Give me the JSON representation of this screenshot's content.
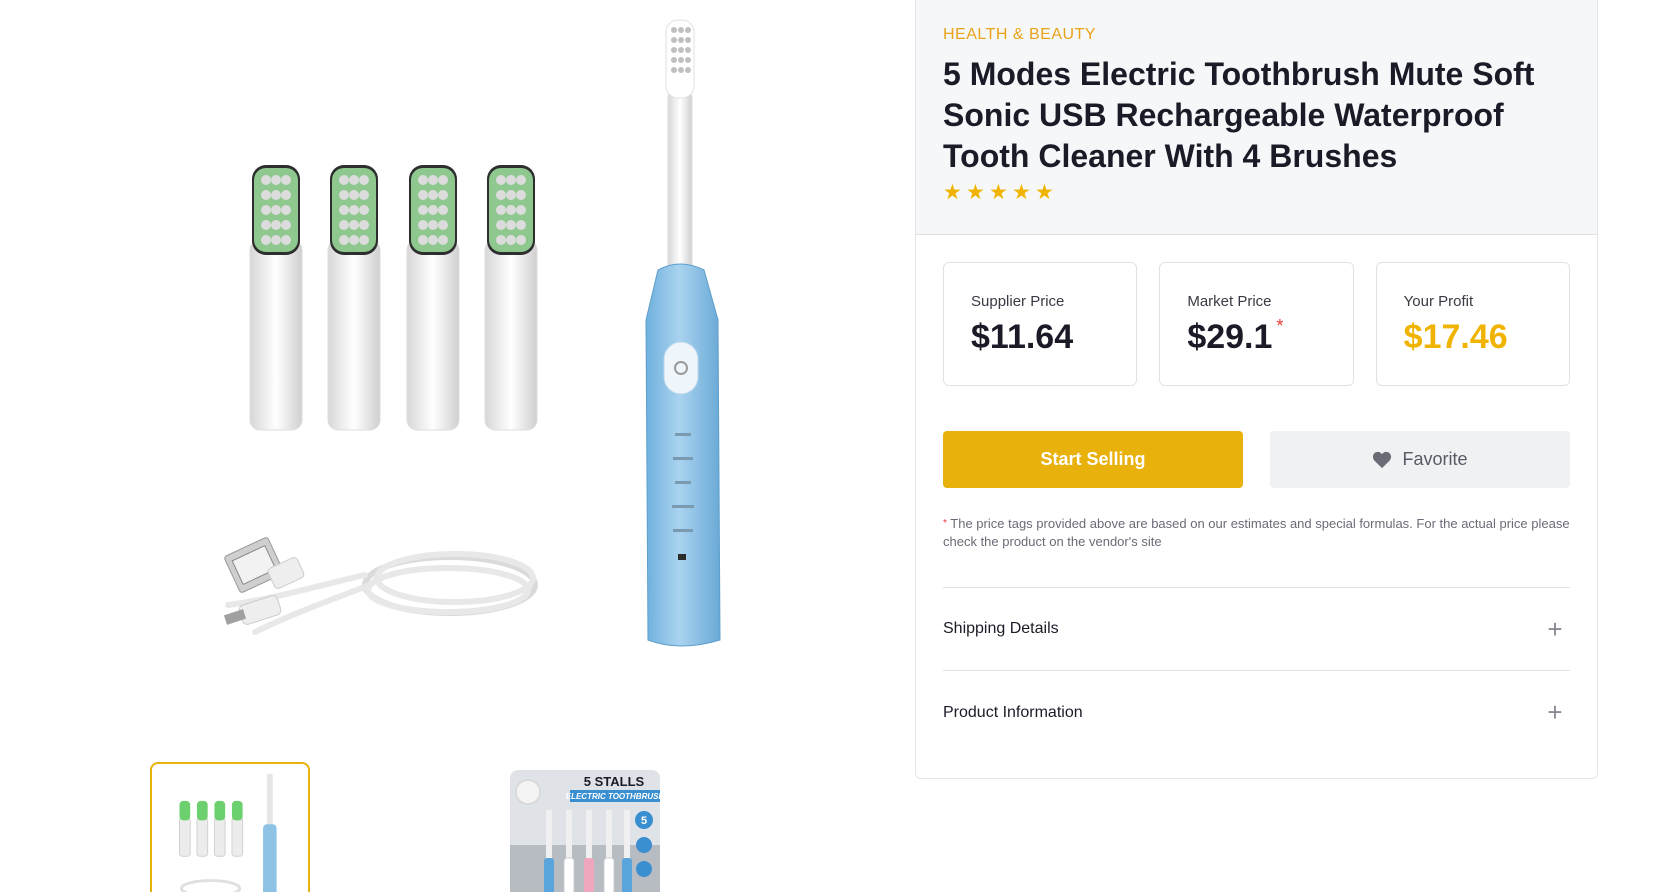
{
  "product": {
    "category": "HEALTH & BEAUTY",
    "title": "5 Modes Electric Toothbrush Mute Soft Sonic USB Rechargeable Waterproof Tooth Cleaner With 4 Brushes",
    "rating": 5
  },
  "prices": {
    "supplier_label": "Supplier Price",
    "supplier_value": "$11.64",
    "market_label": "Market Price",
    "market_value": "$29.1",
    "market_asterisk": "*",
    "profit_label": "Your Profit",
    "profit_value": "$17.46"
  },
  "actions": {
    "start_selling": "Start Selling",
    "favorite": "Favorite"
  },
  "note": {
    "asterisk": "*",
    "text": "The price tags provided above are based on our estimates and special formulas. For the actual price please check the product on the vendor's site"
  },
  "accordion": [
    {
      "label": "Shipping Details",
      "icon": "plus-icon"
    },
    {
      "label": "Product Information",
      "icon": "plus-icon"
    }
  ],
  "thumbnails": {
    "second_title": "5 STALLS",
    "second_subtitle": "ELECTRIC TOOTHBRUSH",
    "second_badge": "5"
  },
  "colors": {
    "accent": "#e9b10c",
    "category": "#e9a318",
    "profit": "#f0b400",
    "asterisk": "#e53935",
    "brush_blue": "#8fc3e6"
  }
}
